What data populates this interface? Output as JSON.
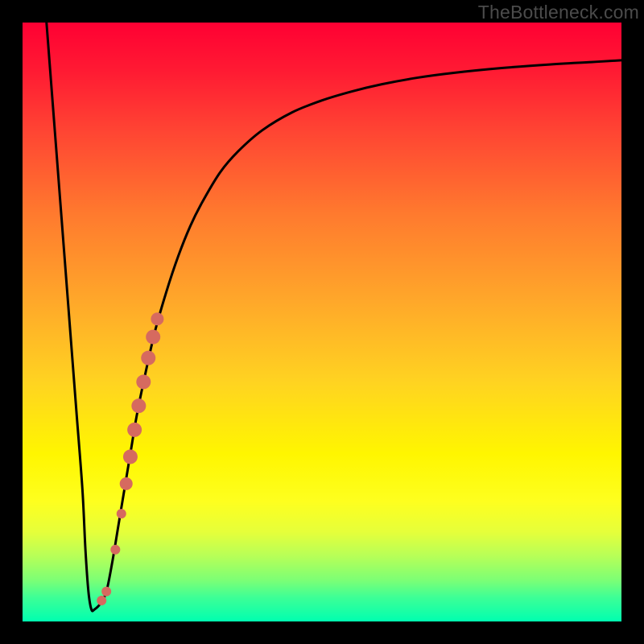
{
  "attribution": "TheBottleneck.com",
  "colors": {
    "curve_stroke": "#000000",
    "marker_fill": "#d66a5f",
    "frame_bg": "#000000"
  },
  "chart_data": {
    "type": "line",
    "title": "",
    "xlabel": "",
    "ylabel": "",
    "xlim": [
      0,
      100
    ],
    "ylim": [
      0,
      100
    ],
    "series": [
      {
        "name": "bottleneck-curve",
        "x": [
          4.0,
          5.0,
          6.0,
          7.0,
          8.0,
          9.0,
          10.0,
          10.5,
          11.0,
          11.5,
          12.0,
          13.0,
          14.0,
          15.0,
          16.0,
          17.0,
          18.0,
          19.0,
          20.0,
          22.0,
          24.0,
          26.0,
          28.0,
          30.0,
          33.0,
          36.0,
          40.0,
          45.0,
          50.0,
          55.0,
          60.0,
          66.0,
          72.0,
          80.0,
          88.0,
          95.0,
          100.0
        ],
        "y": [
          100.0,
          87.0,
          74.0,
          61.0,
          48.0,
          35.0,
          22.0,
          12.0,
          5.0,
          2.0,
          2.0,
          3.0,
          5.0,
          10.0,
          16.0,
          22.0,
          28.0,
          34.0,
          39.0,
          48.0,
          55.0,
          61.0,
          66.0,
          70.0,
          75.0,
          78.5,
          82.0,
          85.0,
          87.0,
          88.5,
          89.7,
          90.8,
          91.6,
          92.4,
          93.0,
          93.4,
          93.7
        ]
      }
    ],
    "markers": {
      "name": "highlighted-points",
      "color": "#d66a5f",
      "points": [
        {
          "x": 13.2,
          "y": 3.5,
          "r": 6
        },
        {
          "x": 14.0,
          "y": 5.0,
          "r": 6
        },
        {
          "x": 15.5,
          "y": 12.0,
          "r": 6
        },
        {
          "x": 16.5,
          "y": 18.0,
          "r": 6
        },
        {
          "x": 17.3,
          "y": 23.0,
          "r": 8
        },
        {
          "x": 18.0,
          "y": 27.5,
          "r": 9
        },
        {
          "x": 18.7,
          "y": 32.0,
          "r": 9
        },
        {
          "x": 19.4,
          "y": 36.0,
          "r": 9
        },
        {
          "x": 20.2,
          "y": 40.0,
          "r": 9
        },
        {
          "x": 21.0,
          "y": 44.0,
          "r": 9
        },
        {
          "x": 21.8,
          "y": 47.5,
          "r": 9
        },
        {
          "x": 22.5,
          "y": 50.5,
          "r": 8
        }
      ]
    }
  }
}
